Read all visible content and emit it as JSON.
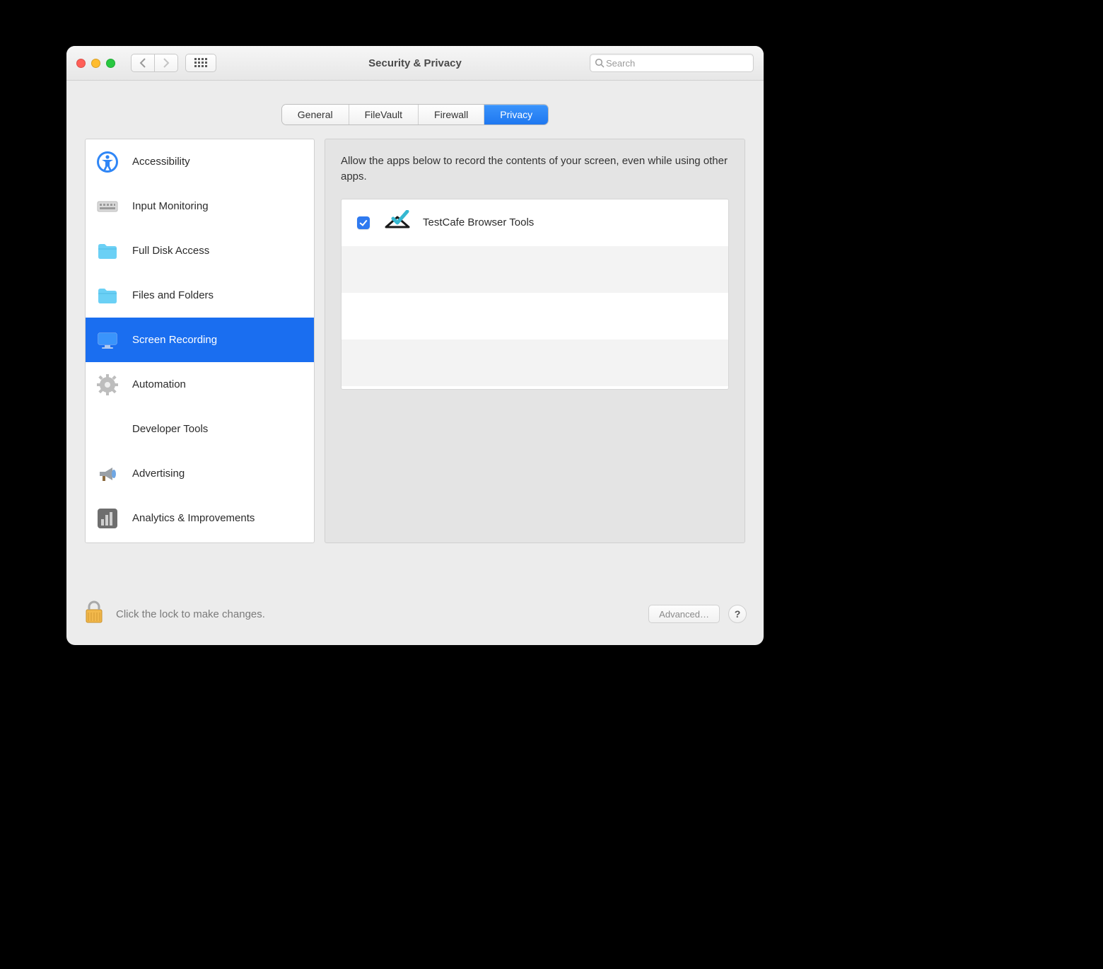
{
  "window_title": "Security & Privacy",
  "search": {
    "placeholder": "Search"
  },
  "tabs": [
    {
      "label": "General",
      "active": false
    },
    {
      "label": "FileVault",
      "active": false
    },
    {
      "label": "Firewall",
      "active": false
    },
    {
      "label": "Privacy",
      "active": true
    }
  ],
  "sidebar": {
    "items": [
      {
        "label": "Accessibility",
        "icon": "accessibility-icon"
      },
      {
        "label": "Input Monitoring",
        "icon": "keyboard-icon"
      },
      {
        "label": "Full Disk Access",
        "icon": "folder-icon"
      },
      {
        "label": "Files and Folders",
        "icon": "folder-icon"
      },
      {
        "label": "Screen Recording",
        "icon": "display-icon",
        "selected": true
      },
      {
        "label": "Automation",
        "icon": "gear-icon"
      },
      {
        "label": "Developer Tools",
        "icon": "blank-icon"
      },
      {
        "label": "Advertising",
        "icon": "megaphone-icon"
      },
      {
        "label": "Analytics & Improvements",
        "icon": "bar-chart-icon"
      }
    ]
  },
  "content": {
    "description": "Allow the apps below to record the contents of your screen, even while using other apps.",
    "apps": [
      {
        "label": "TestCafe Browser Tools",
        "checked": true,
        "icon": "testcafe-icon"
      }
    ]
  },
  "footer": {
    "lock_text": "Click the lock to make changes.",
    "advanced_label": "Advanced…",
    "help_label": "?"
  }
}
